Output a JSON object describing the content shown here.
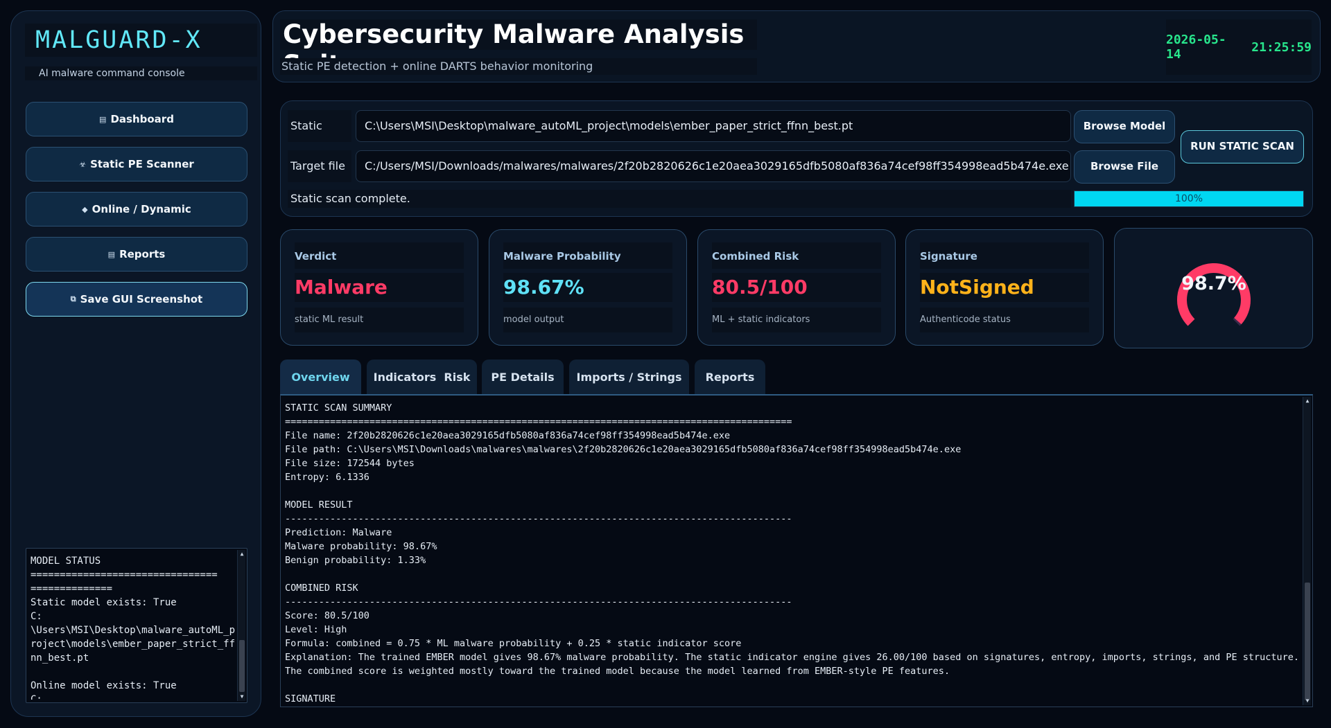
{
  "sidebar": {
    "brand": "MALGUARD-X",
    "tagline": "AI malware command console",
    "nav": [
      {
        "icon": "▤",
        "label": "Dashboard"
      },
      {
        "icon": "☣",
        "label": "Static PE Scanner"
      },
      {
        "icon": "◆",
        "label": "Online / Dynamic"
      },
      {
        "icon": "▤",
        "label": "Reports"
      },
      {
        "icon": "⧉",
        "label": "Save GUI Screenshot"
      }
    ],
    "model_status": "MODEL STATUS\n================================\n==============\nStatic model exists: True\nC:\n\\Users\\MSI\\Desktop\\malware_autoML_project\\models\\ember_paper_strict_ffnn_best.pt\n\nOnline model exists: True\nC:"
  },
  "header": {
    "title": "Cybersecurity Malware Analysis Suite",
    "subtitle": "Static PE detection + online DARTS behavior monitoring",
    "date": "2026-05-14",
    "time": "21:25:59"
  },
  "scan": {
    "static_model_label": "Static model",
    "static_model_path": "C:\\Users\\MSI\\Desktop\\malware_autoML_project\\models\\ember_paper_strict_ffnn_best.pt",
    "browse_model": "Browse Model",
    "target_file_label": "Target file",
    "target_file_path": "C:/Users/MSI/Downloads/malwares/malwares/2f20b2820626c1e20aea3029165dfb5080af836a74cef98ff354998ead5b474e.exe",
    "browse_file": "Browse File",
    "run_button": "RUN STATIC SCAN",
    "status": "Static scan complete.",
    "progress": 100,
    "progress_text": "100%"
  },
  "cards": [
    {
      "title": "Verdict",
      "value": "Malware",
      "sub": "static ML result",
      "color": "#ff3b66"
    },
    {
      "title": "Malware Probability",
      "value": "98.67%",
      "sub": "model output",
      "color": "#5fe1f7"
    },
    {
      "title": "Combined Risk",
      "value": "80.5/100 (High)",
      "sub": "ML + static indicators",
      "color": "#ff3b66"
    },
    {
      "title": "Signature",
      "value": "NotSigned",
      "sub": "Authenticode status",
      "color": "#ffb21a"
    }
  ],
  "gauge": {
    "value": 98.7,
    "label": "98.7%",
    "color": "#ff3b66"
  },
  "tabs": [
    {
      "label": "Overview",
      "active": true
    },
    {
      "label": "Indicators  Risk",
      "active": false
    },
    {
      "label": "PE Details",
      "active": false
    },
    {
      "label": "Imports / Strings",
      "active": false
    },
    {
      "label": "Reports",
      "active": false
    }
  ],
  "output_text": "STATIC SCAN SUMMARY\n==========================================================================================\nFile name: 2f20b2820626c1e20aea3029165dfb5080af836a74cef98ff354998ead5b474e.exe\nFile path: C:\\Users\\MSI\\Downloads\\malwares\\malwares\\2f20b2820626c1e20aea3029165dfb5080af836a74cef98ff354998ead5b474e.exe\nFile size: 172544 bytes\nEntropy: 6.1336\n\nMODEL RESULT\n------------------------------------------------------------------------------------------\nPrediction: Malware\nMalware probability: 98.67%\nBenign probability: 1.33%\n\nCOMBINED RISK\n------------------------------------------------------------------------------------------\nScore: 80.5/100\nLevel: High\nFormula: combined = 0.75 * ML malware probability + 0.25 * static indicator score\nExplanation: The trained EMBER model gives 98.67% malware probability. The static indicator engine gives 26.00/100 based on signatures, entropy, imports, strings, and PE structure. The combined score is weighted mostly toward the trained model because the model learned from EMBER-style PE features.\n\nSIGNATURE"
}
